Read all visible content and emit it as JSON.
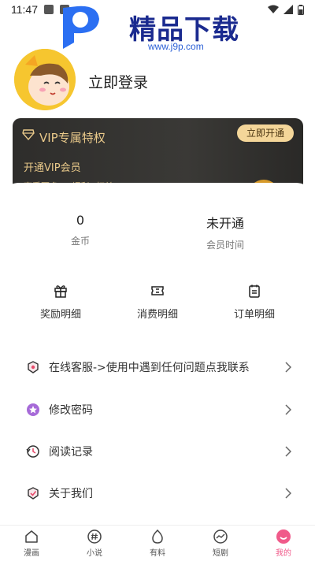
{
  "status": {
    "time": "11:47"
  },
  "watermark": {
    "brand": "精品下载",
    "url": "www.j9p.com"
  },
  "profile": {
    "login_label": "立即登录"
  },
  "vip": {
    "title": "VIP专属特权",
    "button": "立即开通",
    "subtitle": "开通VIP会员",
    "description": "享受更多VIP福利&权益"
  },
  "stats": [
    {
      "value": "0",
      "label": "金币"
    },
    {
      "value": "未开通",
      "label": "会员时间"
    }
  ],
  "shortcuts": [
    {
      "label": "奖励明细",
      "icon": "gift-icon"
    },
    {
      "label": "消费明细",
      "icon": "ticket-icon"
    },
    {
      "label": "订单明细",
      "icon": "clipboard-icon"
    }
  ],
  "menu": [
    {
      "label": "在线客服->使用中遇到任何问题点我联系",
      "icon": "service-icon"
    },
    {
      "label": "修改密码",
      "icon": "password-icon"
    },
    {
      "label": "阅读记录",
      "icon": "history-icon"
    },
    {
      "label": "关于我们",
      "icon": "about-icon"
    }
  ],
  "nav": [
    {
      "label": "漫画",
      "icon": "home-icon"
    },
    {
      "label": "小说",
      "icon": "hash-icon"
    },
    {
      "label": "有料",
      "icon": "egg-icon"
    },
    {
      "label": "短剧",
      "icon": "chart-icon"
    },
    {
      "label": "我的",
      "icon": "smile-icon",
      "active": true
    }
  ],
  "colors": {
    "accent": "#f05a8a",
    "vip_gold": "#e9c98a",
    "vip_button": "#f4d699"
  }
}
